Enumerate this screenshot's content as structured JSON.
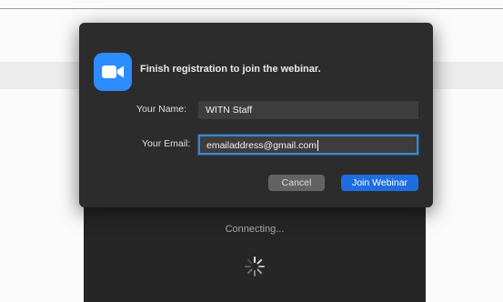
{
  "dialog": {
    "title": "Finish registration to join the webinar.",
    "name_label": "Your Name:",
    "name_value": "WITN Staff",
    "email_label": "Your Email:",
    "email_value": "emailaddress@gmail.com",
    "cancel_label": "Cancel",
    "join_label": "Join Webinar",
    "app_icon": "zoom-camera-icon"
  },
  "background_window": {
    "status_text": "Connecting...",
    "spinner_icon": "loading-spinner-icon"
  },
  "colors": {
    "accent": "#2d8cff",
    "join_button": "#1f6ee0",
    "dialog_bg": "#2c2c2c",
    "focus_ring": "#3d86c7"
  }
}
